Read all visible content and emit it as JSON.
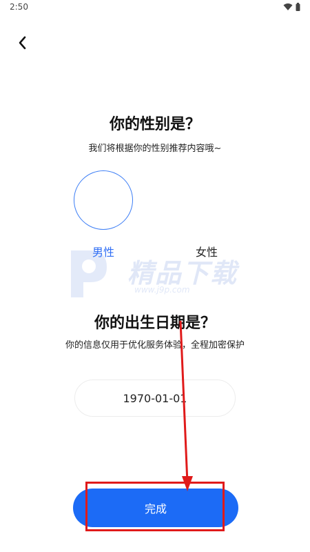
{
  "status_bar": {
    "time": "2:50"
  },
  "header": {
    "back_icon": "chevron-left-icon"
  },
  "gender_section": {
    "title": "你的性别是？",
    "subtitle": "我们将根据你的性别推荐内容哦~",
    "options": [
      {
        "label": "男性",
        "selected": true
      },
      {
        "label": "女性",
        "selected": false
      }
    ]
  },
  "birth_section": {
    "title": "你的出生日期是？",
    "subtitle": "你的信息仅用于优化服务体验，全程加密保护",
    "date_value": "1970-01-01"
  },
  "actions": {
    "done_label": "完成"
  },
  "watermark": {
    "text": "精品下载",
    "url": "www.j9p.com"
  },
  "colors": {
    "accent": "#1c6bf6",
    "selected_text": "#2f6ef5",
    "annotation": "#e01a1a"
  }
}
